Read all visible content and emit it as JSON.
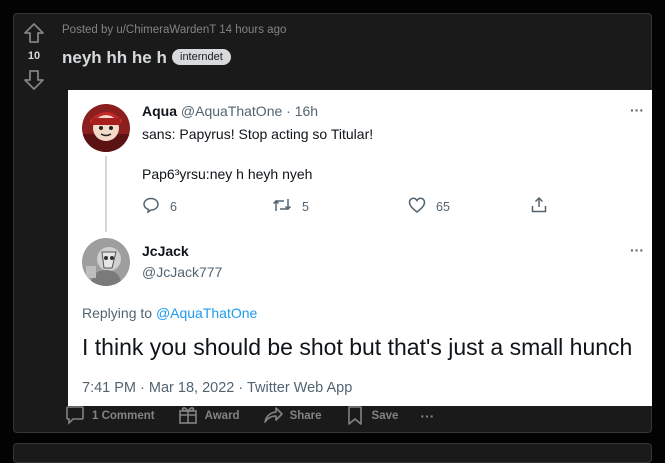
{
  "post": {
    "posted_by": "Posted by u/ChimeraWardenT 14 hours ago",
    "votes": "10",
    "title": "neyh hh he h",
    "flair": "interndet"
  },
  "tweet1": {
    "name": "Aqua",
    "handle_time": " @AquaThatOne · 16h",
    "line1": "sans: Papyrus! Stop acting so Titular!",
    "line2": "Pap6³yrsu:ney h heyh nyeh",
    "replies": "6",
    "retweets": "5",
    "likes": "65",
    "more": "···"
  },
  "tweet2": {
    "name": "JcJack",
    "handle": "@JcJack777",
    "replying_prefix": "Replying to ",
    "replying_to": "@AquaThatOne",
    "text": "I think you should be shot but that's just a small hunch",
    "meta": "7:41 PM · Mar 18, 2022 · Twitter Web App",
    "more": "···"
  },
  "actions": {
    "comment": "1 Comment",
    "award": "Award",
    "share": "Share",
    "save": "Save",
    "more": "···"
  },
  "colors": {
    "background": "#030303",
    "card": "#1a1a1b",
    "link_blue": "#1d9bf0"
  }
}
